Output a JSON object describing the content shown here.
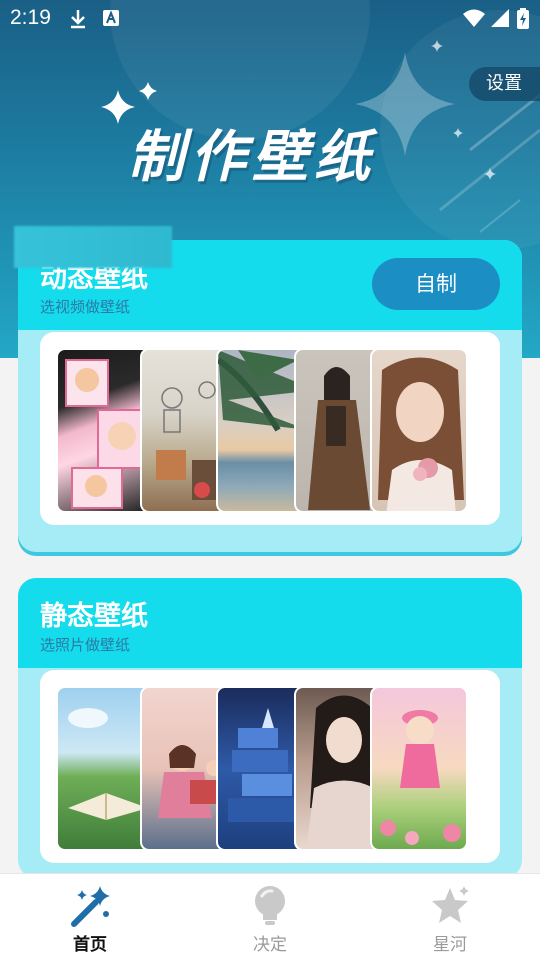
{
  "status_bar": {
    "time": "2:19"
  },
  "header": {
    "title": "制作壁纸",
    "settings_label": "设置"
  },
  "dynamic_card": {
    "title": "动态壁纸",
    "subtitle": "选视频做壁纸",
    "make_button": "自制",
    "thumbnails": [
      "anime-girl-comic",
      "doodle-wall-photo",
      "palm-beach",
      "woman-brown-coat",
      "woman-pink-flower"
    ]
  },
  "static_card": {
    "title": "静态壁纸",
    "subtitle": "选照片做壁纸",
    "thumbnails": [
      "meadow-book",
      "girl-reading-illustration",
      "blue-book-tower",
      "woman-traditional-dress",
      "3d-girl-flowers"
    ]
  },
  "bottom_nav": {
    "items": [
      {
        "label": "首页",
        "icon": "magic-wand-icon",
        "active": true
      },
      {
        "label": "决定",
        "icon": "lightbulb-icon",
        "active": false
      },
      {
        "label": "星河",
        "icon": "star-icon",
        "active": false
      }
    ]
  },
  "colors": {
    "accent": "#14dced",
    "button": "#1b8ec4",
    "header": "#1d7ea3"
  }
}
